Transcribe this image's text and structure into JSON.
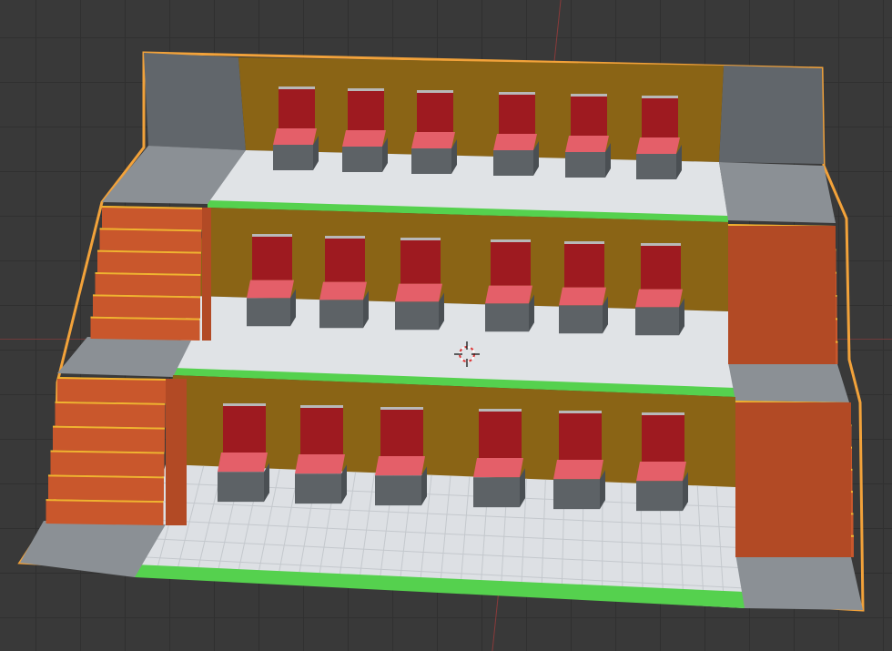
{
  "app": "3D viewport",
  "scene": {
    "object": "auditorium-tiers",
    "tiers": 3,
    "seats_per_row": 6,
    "selection_outline": true
  },
  "colors": {
    "background": "#393939",
    "grid_line": "#303030",
    "selection_outline": "#f2a23a",
    "back_wall": "#8a6415",
    "side_wall": "#5f6469",
    "floor_light": "#dfe2e6",
    "platform_edge": "#55d14e",
    "seat_back": "#9e1a20",
    "seat_cushion": "#e45f69",
    "seat_base": "#5d6266",
    "stairs": "#c9572c",
    "stair_edge": "#f0b330",
    "landing": "#8a8f94"
  },
  "icons": {
    "cursor": "3d-cursor-icon"
  }
}
